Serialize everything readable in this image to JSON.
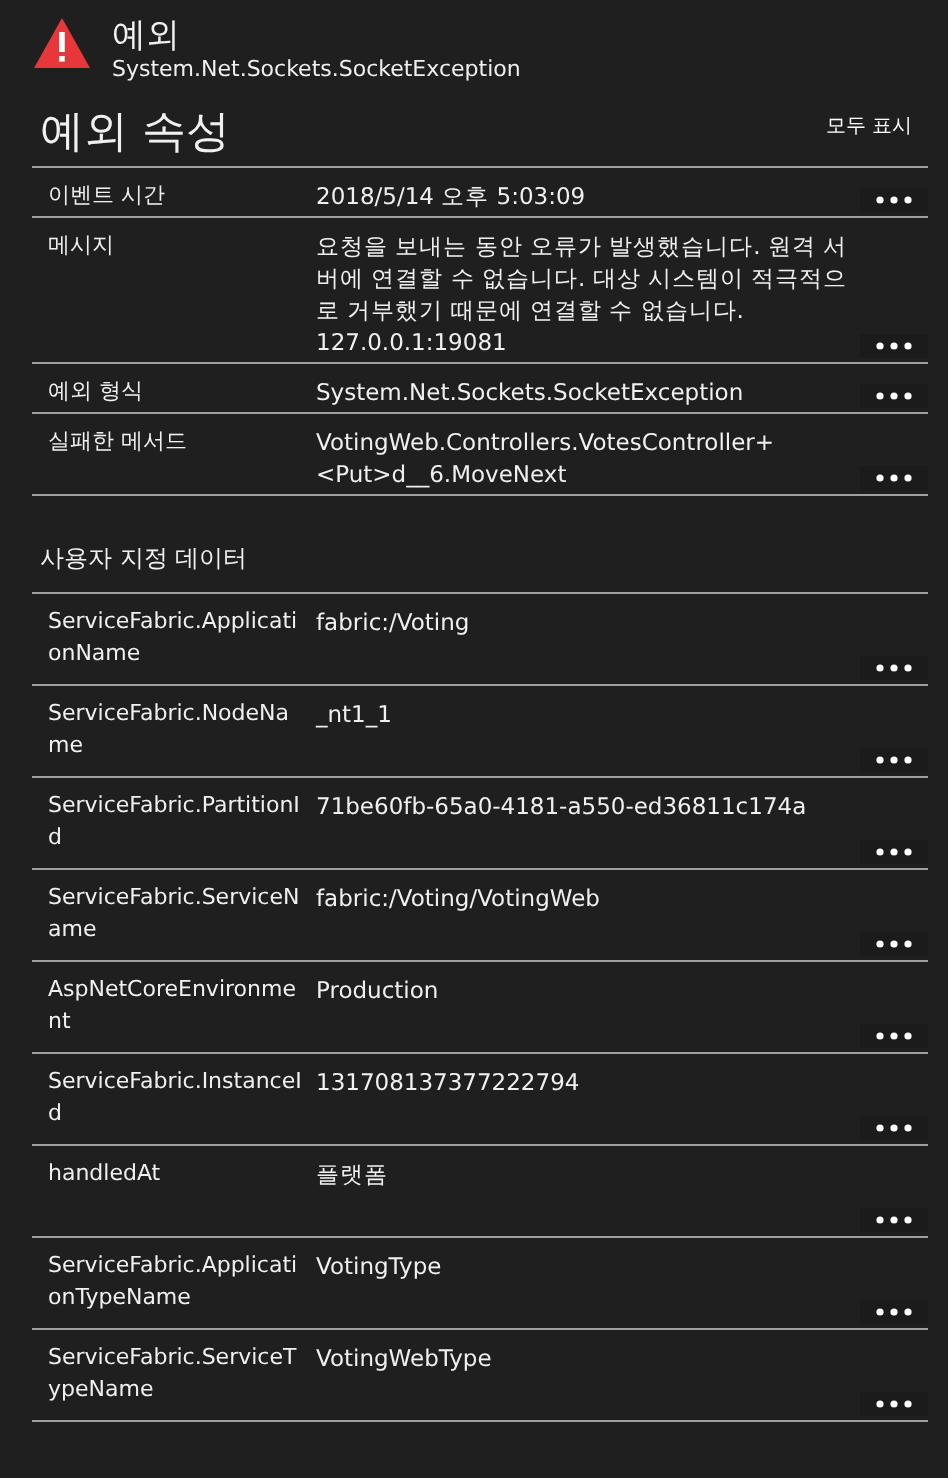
{
  "header": {
    "title": "예외",
    "subtitle": "System.Net.Sockets.SocketException"
  },
  "properties_section": {
    "title": "예외 속성",
    "show_all": "모두 표시"
  },
  "properties": [
    {
      "key": "이벤트 시간",
      "value": "2018/5/14 오후 5:03:09"
    },
    {
      "key": "메시지",
      "value": "요청을 보내는 동안 오류가 발생했습니다. 원격 서버에 연결할 수 없습니다. 대상 시스템이 적극적으로 거부했기 때문에 연결할 수 없습니다. 127.0.0.1:19081"
    },
    {
      "key": "예외 형식",
      "value": "System.Net.Sockets.SocketException"
    },
    {
      "key": "실패한 메서드",
      "value": "VotingWeb.Controllers.VotesController+<Put>d__6.MoveNext"
    }
  ],
  "custom_data": {
    "title": "사용자 지정 데이터",
    "rows": [
      {
        "key": "ServiceFabric.ApplicationName",
        "value": "fabric:/Voting"
      },
      {
        "key": "ServiceFabric.NodeName",
        "value": "_nt1_1"
      },
      {
        "key": "ServiceFabric.PartitionId",
        "value": "71be60fb-65a0-4181-a550-ed36811c174a"
      },
      {
        "key": "ServiceFabric.ServiceName",
        "value": "fabric:/Voting/VotingWeb"
      },
      {
        "key": "AspNetCoreEnvironment",
        "value": "Production"
      },
      {
        "key": "ServiceFabric.InstanceId",
        "value": "131708137377222794"
      },
      {
        "key": "handledAt",
        "value": "플랫폼"
      },
      {
        "key": "ServiceFabric.ApplicationTypeName",
        "value": "VotingType"
      },
      {
        "key": "ServiceFabric.ServiceTypeName",
        "value": "VotingWebType"
      }
    ]
  }
}
